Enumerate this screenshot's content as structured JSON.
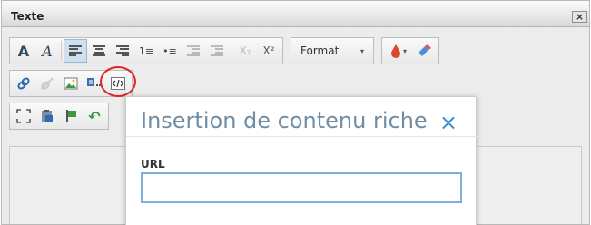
{
  "window": {
    "title": "Texte",
    "close_label": "×"
  },
  "toolbar": {
    "bold_label": "A",
    "italic_label": "A",
    "subscript_label": "X₂",
    "superscript_label": "X²",
    "format_label": "Format",
    "format_caret": "▾",
    "color_caret": "▾",
    "list_ordered_label": "1≡",
    "list_unordered_label": "•≡",
    "source_label": "</>",
    "undo_label": "↶"
  },
  "dialog": {
    "title": "Insertion de contenu riche",
    "close_label": "×",
    "url_label": "URL",
    "url_value": "",
    "url_placeholder": ""
  },
  "colors": {
    "accent_blue": "#3d8cd2",
    "dialog_title": "#6f8ea6",
    "highlight_circle": "#e02424"
  }
}
